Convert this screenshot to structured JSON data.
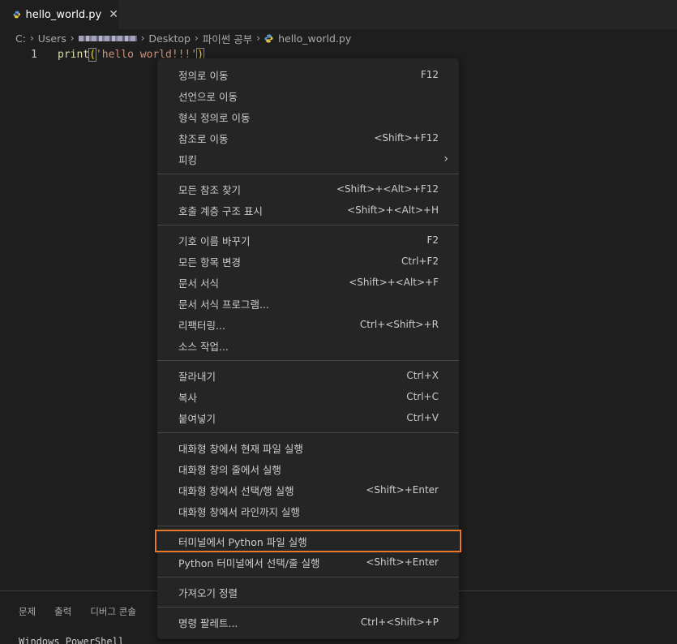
{
  "tab": {
    "label": "hello_world.py",
    "close": "✕"
  },
  "breadcrumb": {
    "items": [
      "C:",
      "Users",
      "Desktop",
      "파이썬 공부",
      "hello_world.py"
    ]
  },
  "editor": {
    "line_number": "1",
    "code": {
      "fn": "print",
      "open": "(",
      "str": "'hello world!!!'",
      "close": ")"
    }
  },
  "panel": {
    "tabs": [
      "문제",
      "출력",
      "디버그 콘솔"
    ],
    "terminal_text": "Windows PowerShell"
  },
  "menu": {
    "groups": [
      [
        {
          "label": "정의로 이동",
          "shortcut": "F12"
        },
        {
          "label": "선언으로 이동",
          "shortcut": ""
        },
        {
          "label": "형식 정의로 이동",
          "shortcut": ""
        },
        {
          "label": "참조로 이동",
          "shortcut": "<Shift>+F12"
        },
        {
          "label": "피킹",
          "shortcut": "",
          "submenu": true
        }
      ],
      [
        {
          "label": "모든 참조 찾기",
          "shortcut": "<Shift>+<Alt>+F12"
        },
        {
          "label": "호출 계층 구조 표시",
          "shortcut": "<Shift>+<Alt>+H"
        }
      ],
      [
        {
          "label": "기호 이름 바꾸기",
          "shortcut": "F2"
        },
        {
          "label": "모든 항목 변경",
          "shortcut": "Ctrl+F2"
        },
        {
          "label": "문서 서식",
          "shortcut": "<Shift>+<Alt>+F"
        },
        {
          "label": "문서 서식 프로그램...",
          "shortcut": ""
        },
        {
          "label": "리팩터링...",
          "shortcut": "Ctrl+<Shift>+R"
        },
        {
          "label": "소스 작업...",
          "shortcut": ""
        }
      ],
      [
        {
          "label": "잘라내기",
          "shortcut": "Ctrl+X"
        },
        {
          "label": "복사",
          "shortcut": "Ctrl+C"
        },
        {
          "label": "붙여넣기",
          "shortcut": "Ctrl+V"
        }
      ],
      [
        {
          "label": "대화형 창에서 현재 파일 실행",
          "shortcut": ""
        },
        {
          "label": "대화형 창의 줄에서 실행",
          "shortcut": ""
        },
        {
          "label": "대화형 창에서 선택/행 실행",
          "shortcut": "<Shift>+Enter"
        },
        {
          "label": "대화형 창에서 라인까지 실행",
          "shortcut": ""
        }
      ],
      [
        {
          "label": "터미널에서 Python 파일 실행",
          "shortcut": "",
          "highlight": true
        },
        {
          "label": "Python 터미널에서 선택/줄 실행",
          "shortcut": "<Shift>+Enter"
        }
      ],
      [
        {
          "label": "가져오기 정렬",
          "shortcut": ""
        }
      ],
      [
        {
          "label": "명령 팔레트...",
          "shortcut": "Ctrl+<Shift>+P"
        }
      ]
    ]
  },
  "colors": {
    "highlight_border": "#e8782a",
    "editor_bg": "#1e1e1e",
    "menu_bg": "#252526"
  }
}
